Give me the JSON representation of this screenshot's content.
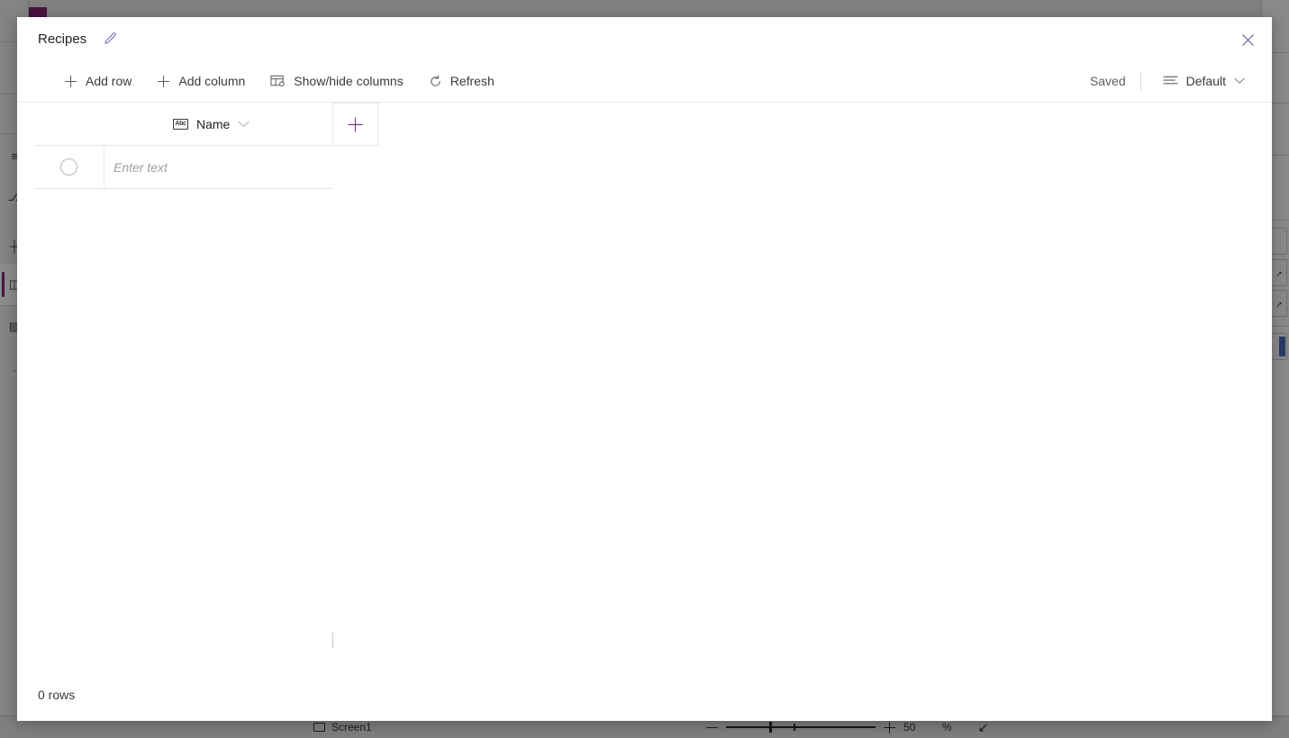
{
  "background": {
    "accent_color": "#4a1342",
    "overlay_color": "#808080",
    "left_rail": {
      "items": [
        {
          "name": "menu-icon",
          "glyph": "≡"
        },
        {
          "name": "tree-icon",
          "glyph": "⎇"
        },
        {
          "name": "insert-icon",
          "glyph": "┼"
        },
        {
          "name": "data-icon",
          "glyph": "◫"
        },
        {
          "name": "media-icon",
          "glyph": "▤"
        },
        {
          "name": "more-icon",
          "glyph": "·"
        }
      ]
    },
    "status_bar": {
      "screen_label": "Screen1",
      "zoom_percent": "50",
      "zoom_unit": "%",
      "minus_label": "−",
      "plus_label": "+",
      "fit_icon": "↙"
    }
  },
  "modal": {
    "title": "Recipes",
    "edit_icon": "pencil-icon",
    "close_icon": "✕",
    "toolbar": {
      "add_row_label": "Add row",
      "add_column_label": "Add column",
      "show_hide_columns_label": "Show/hide columns",
      "refresh_label": "Refresh",
      "saved_label": "Saved",
      "view_label": "Default",
      "view_chevron": "⌄"
    },
    "grid": {
      "type_chip": "Abc",
      "column_name": "Name",
      "add_column_plus": "+",
      "row_placeholder": "Enter text",
      "row_value": ""
    },
    "footer": {
      "row_count_label": "0 rows"
    }
  }
}
